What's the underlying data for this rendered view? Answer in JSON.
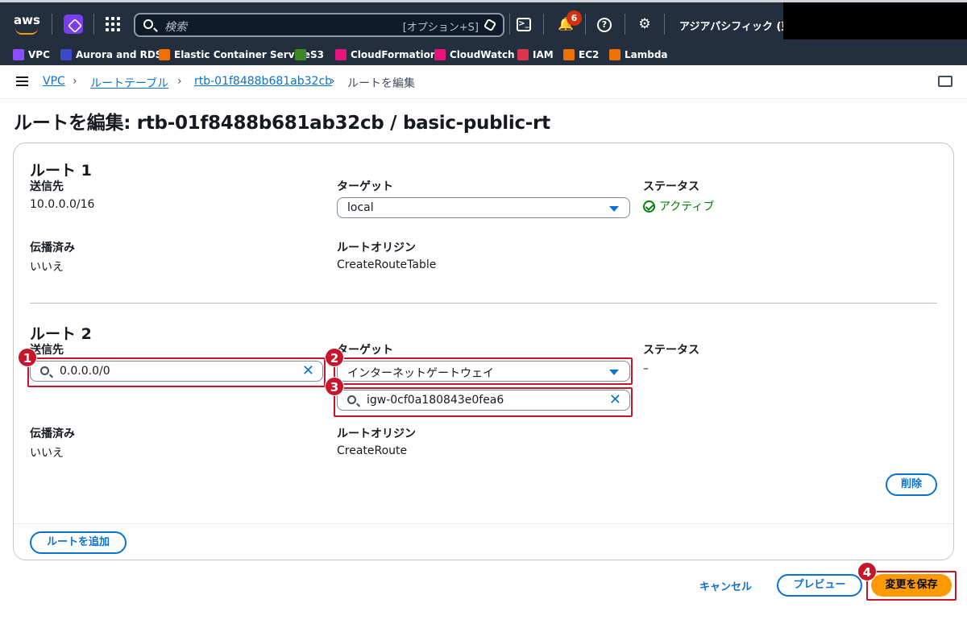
{
  "topnav": {
    "logo_text": "aws",
    "search_placeholder": "検索",
    "search_shortcut": "[オプション+S]",
    "notification_count": "6",
    "region": "アジアパシフィック (東京)"
  },
  "favorites": [
    {
      "label": "VPC",
      "color": "#8c4fff"
    },
    {
      "label": "Aurora and RDS",
      "color": "#3b48cc"
    },
    {
      "label": "Elastic Container Service",
      "color": "#ed7100"
    },
    {
      "label": "S3",
      "color": "#3f8624"
    },
    {
      "label": "CloudFormation",
      "color": "#e7157b"
    },
    {
      "label": "CloudWatch",
      "color": "#e7157b"
    },
    {
      "label": "IAM",
      "color": "#dd344c"
    },
    {
      "label": "EC2",
      "color": "#ed7100"
    },
    {
      "label": "Lambda",
      "color": "#ed7100"
    }
  ],
  "breadcrumb": {
    "items": [
      "VPC",
      "ルートテーブル",
      "rtb-01f8488b681ab32cb",
      "ルートを編集"
    ]
  },
  "page_title": "ルートを編集: rtb-01f8488b681ab32cb / basic-public-rt",
  "routes": [
    {
      "heading": "ルート 1",
      "dest_label": "送信先",
      "dest_value": "10.0.0.0/16",
      "target_label": "ターゲット",
      "target_value": "local",
      "status_label": "ステータス",
      "status_value": "アクティブ",
      "propagated_label": "伝播済み",
      "propagated_value": "いいえ",
      "origin_label": "ルートオリジン",
      "origin_value": "CreateRouteTable"
    },
    {
      "heading": "ルート 2",
      "dest_label": "送信先",
      "dest_value": "0.0.0.0/0",
      "target_label": "ターゲット",
      "target_value": "インターネットゲートウェイ",
      "target_id_value": "igw-0cf0a180843e0fea6",
      "status_label": "ステータス",
      "status_value": "–",
      "propagated_label": "伝播済み",
      "propagated_value": "いいえ",
      "origin_label": "ルートオリジン",
      "origin_value": "CreateRoute",
      "remove_label": "削除"
    }
  ],
  "add_route_label": "ルートを追加",
  "footer": {
    "cancel_label": "キャンセル",
    "preview_label": "プレビュー",
    "save_label": "変更を保存"
  },
  "annotations": {
    "badge1": "1",
    "badge2": "2",
    "badge3": "3",
    "badge4": "4",
    "highlight_color": "#c7162b"
  },
  "colors": {
    "link": "#0972d3",
    "primary": "#ff9900",
    "success": "#037f0c",
    "nav_bg": "#232f3e"
  }
}
